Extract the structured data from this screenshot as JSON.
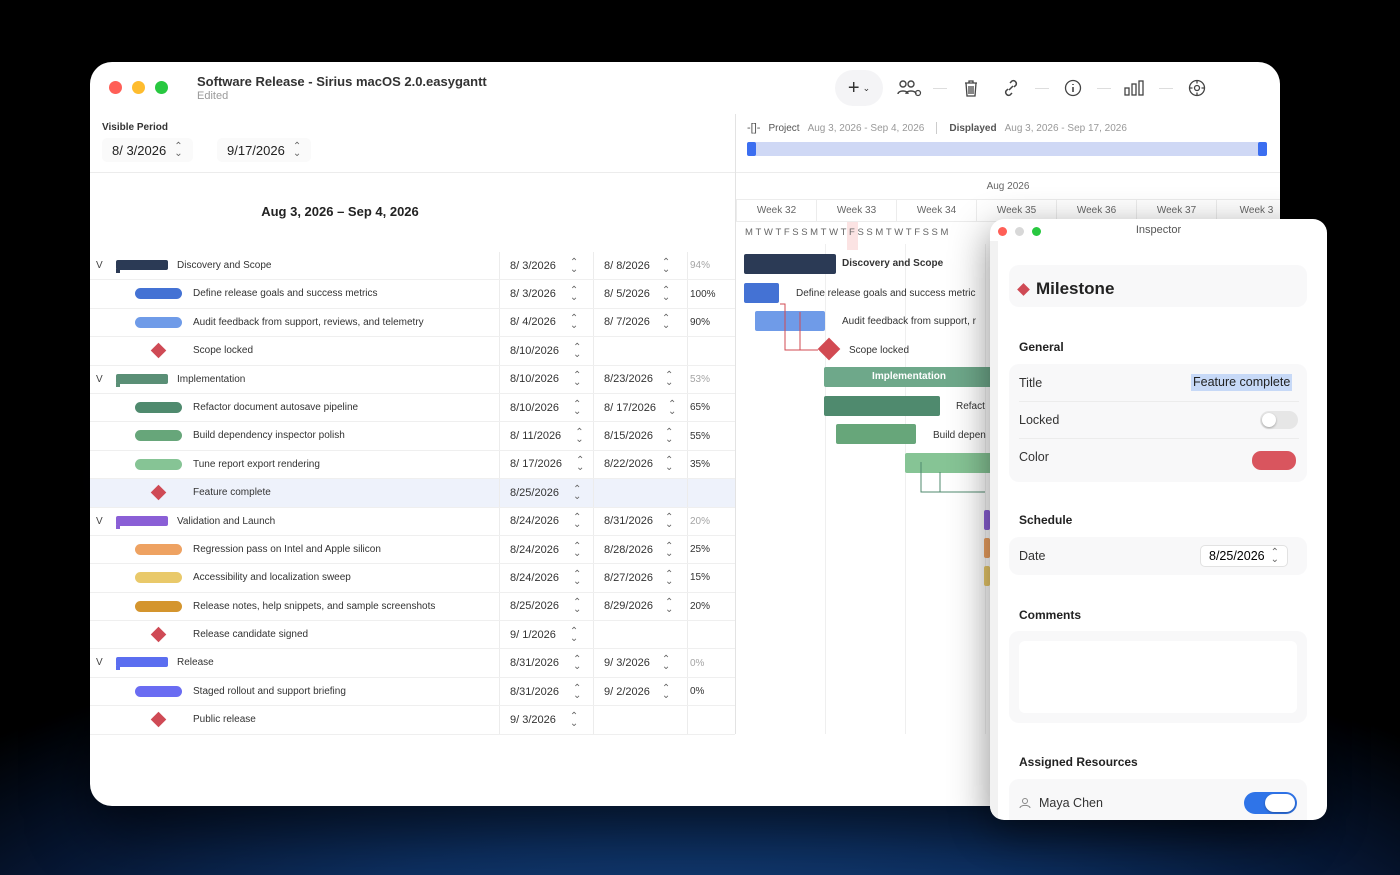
{
  "window": {
    "title": "Software Release - Sirius macOS 2.0.easygantt",
    "subtitle": "Edited",
    "toolbar_icons": [
      "add-icon",
      "resources-icon",
      "trash-icon",
      "link-icon",
      "info-icon",
      "chart-icon",
      "settings-icon"
    ]
  },
  "visible_period": {
    "label": "Visible Period",
    "start": "8/ 3/2026",
    "end": "9/17/2026"
  },
  "outline": {
    "range_title": "Aug 3, 2026 – Sep 4, 2026",
    "rows": [
      {
        "kind": "summary",
        "name": "Discovery and Scope",
        "start": "8/ 3/2026",
        "end": "8/ 8/2026",
        "pct": "94%",
        "color": "#2b3a55"
      },
      {
        "kind": "task",
        "name": "Define release goals and success metrics",
        "start": "8/ 3/2026",
        "end": "8/ 5/2026",
        "pct": "100%",
        "color": "#4472d4"
      },
      {
        "kind": "task",
        "name": "Audit feedback from support, reviews, and telemetry",
        "start": "8/ 4/2026",
        "end": "8/ 7/2026",
        "pct": "90%",
        "color": "#6f9be8"
      },
      {
        "kind": "milestone",
        "name": "Scope locked",
        "start": "8/10/2026",
        "end": "",
        "pct": "",
        "color": "#cf4a55"
      },
      {
        "kind": "summary",
        "name": "Implementation",
        "start": "8/10/2026",
        "end": "8/23/2026",
        "pct": "53%",
        "color": "#5a8f76"
      },
      {
        "kind": "task",
        "name": "Refactor document autosave pipeline",
        "start": "8/10/2026",
        "end": "8/ 17/2026",
        "pct": "65%",
        "color": "#4f8a6e"
      },
      {
        "kind": "task",
        "name": "Build dependency inspector polish",
        "start": "8/ 11/2026",
        "end": "8/15/2026",
        "pct": "55%",
        "color": "#67a67a"
      },
      {
        "kind": "task",
        "name": "Tune report export rendering",
        "start": "8/ 17/2026",
        "end": "8/22/2026",
        "pct": "35%",
        "color": "#86c495"
      },
      {
        "kind": "milestone",
        "name": "Feature complete",
        "start": "8/25/2026",
        "end": "",
        "pct": "",
        "color": "#cf4a55",
        "selected": true
      },
      {
        "kind": "summary",
        "name": "Validation and Launch",
        "start": "8/24/2026",
        "end": "8/31/2026",
        "pct": "20%",
        "color": "#8a5fd6"
      },
      {
        "kind": "task",
        "name": "Regression pass on Intel and Apple silicon",
        "start": "8/24/2026",
        "end": "8/28/2026",
        "pct": "25%",
        "color": "#eea262"
      },
      {
        "kind": "task",
        "name": "Accessibility and localization sweep",
        "start": "8/24/2026",
        "end": "8/27/2026",
        "pct": "15%",
        "color": "#e9c96a"
      },
      {
        "kind": "task",
        "name": "Release notes, help snippets, and sample screenshots",
        "start": "8/25/2026",
        "end": "8/29/2026",
        "pct": "20%",
        "color": "#d4952e"
      },
      {
        "kind": "milestone",
        "name": "Release candidate signed",
        "start": "9/ 1/2026",
        "end": "",
        "pct": "",
        "color": "#cf4a55"
      },
      {
        "kind": "summary",
        "name": "Release",
        "start": "8/31/2026",
        "end": "9/ 3/2026",
        "pct": "0%",
        "color": "#5b6ef0"
      },
      {
        "kind": "task",
        "name": "Staged rollout and support briefing",
        "start": "8/31/2026",
        "end": "9/ 2/2026",
        "pct": "0%",
        "color": "#6a6cf2"
      },
      {
        "kind": "milestone",
        "name": "Public release",
        "start": "9/ 3/2026",
        "end": "",
        "pct": "",
        "color": "#cf4a55"
      }
    ]
  },
  "gantt": {
    "project_label": "Project",
    "project_range": "Aug 3, 2026 - Sep 4, 2026",
    "displayed_label": "Displayed",
    "displayed_range": "Aug 3, 2026 - Sep 17, 2026",
    "month": "Aug 2026",
    "weeks": [
      "Week 32",
      "Week 33",
      "Week 34",
      "Week 35",
      "Week 36",
      "Week 37",
      "Week 3"
    ],
    "days": "MTWTFSSMTWTFSSMTWTFSSM",
    "bar_labels": {
      "discovery": "Discovery and Scope",
      "define": "Define release goals and success metric",
      "audit": "Audit feedback from support, r",
      "scope": "Scope locked",
      "implementation": "Implementation",
      "refactor": "Refact",
      "build": "Build depen"
    }
  },
  "inspector": {
    "window_title": "Inspector",
    "type_label": "Milestone",
    "general_label": "General",
    "title_label": "Title",
    "title_value": "Feature complete",
    "locked_label": "Locked",
    "locked": false,
    "color_label": "Color",
    "color_value": "#d9555e",
    "schedule_label": "Schedule",
    "date_label": "Date",
    "date_value": "8/25/2026",
    "comments_label": "Comments",
    "comments_value": "",
    "resources_label": "Assigned Resources",
    "resource_name": "Maya Chen",
    "resource_assigned": true
  }
}
